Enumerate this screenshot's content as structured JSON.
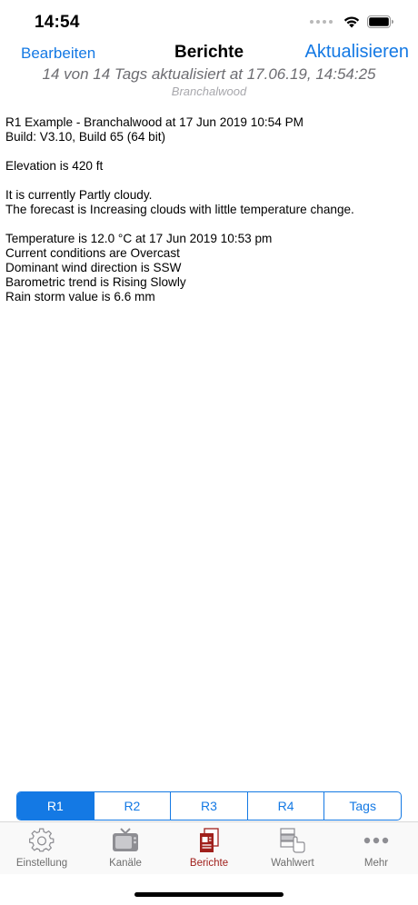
{
  "status_bar": {
    "time": "14:54",
    "icons": [
      "signal-dots-icon",
      "wifi-icon",
      "battery-icon"
    ]
  },
  "nav": {
    "left_button": "Bearbeiten",
    "title": "Berichte",
    "right_button": "Aktualisieren",
    "subtitle": "14 von 14 Tags aktualisiert at 17.06.19, 14:54:25",
    "station": "Branchalwood"
  },
  "report": {
    "lines": [
      "R1 Example - Branchalwood at 17 Jun 2019 10:54 PM",
      "Build: V3.10, Build 65 (64 bit)",
      "",
      "Elevation is 420 ft",
      "",
      "It is currently Partly cloudy.",
      "The forecast is Increasing clouds with little temperature change.",
      "",
      "Temperature is 12.0 °C at 17 Jun 2019 10:53 pm",
      "Current conditions are Overcast",
      "Dominant wind direction is SSW",
      "Barometric trend is Rising Slowly",
      "Rain storm value is 6.6 mm"
    ]
  },
  "segments": {
    "items": [
      "R1",
      "R2",
      "R3",
      "R4",
      "Tags"
    ],
    "selected": "R1"
  },
  "tab_bar": {
    "items": [
      {
        "label": "Einstellung",
        "icon": "gear-icon"
      },
      {
        "label": "Kanäle",
        "icon": "tv-icon"
      },
      {
        "label": "Berichte",
        "icon": "report-icon"
      },
      {
        "label": "Wahlwert",
        "icon": "picker-icon"
      },
      {
        "label": "Mehr",
        "icon": "more-icon"
      }
    ],
    "selected": "Berichte"
  },
  "colors": {
    "accent": "#1479e4",
    "active_tab": "#a0201c",
    "inactive_tab": "#8e8e93"
  }
}
